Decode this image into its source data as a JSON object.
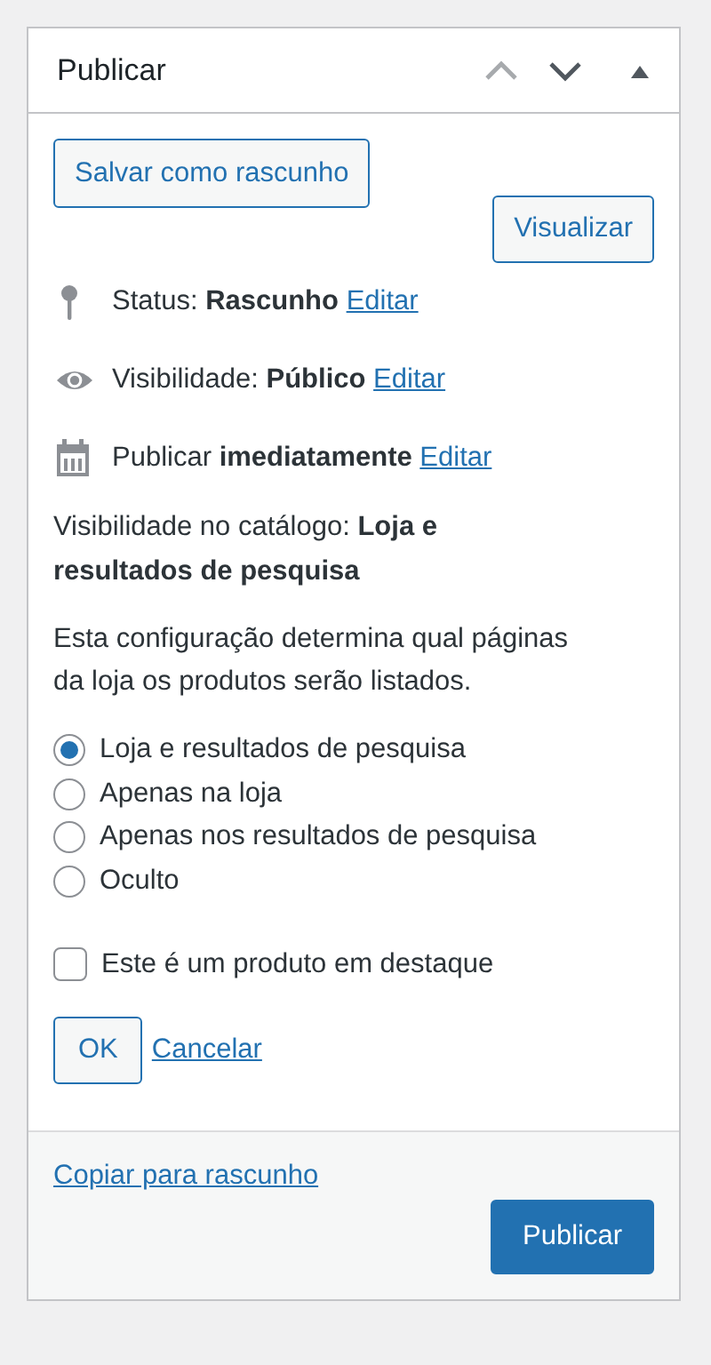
{
  "panel": {
    "title": "Publicar",
    "header_controls": [
      {
        "kind": "up",
        "disabled": true
      },
      {
        "kind": "down",
        "disabled": false
      },
      {
        "kind": "toggle",
        "disabled": false
      }
    ]
  },
  "actions": [
    {
      "label": "Salvar como rascunho"
    },
    {
      "label": "Visualizar"
    }
  ],
  "misc": [
    {
      "kind": "status",
      "label": "Status: ",
      "value": "Rascunho",
      "link": "Editar"
    },
    {
      "kind": "visibility",
      "label": "Visibilidade: ",
      "value": "Público",
      "link": "Editar"
    },
    {
      "kind": "schedule",
      "label": "Publicar ",
      "value": "imediatamente",
      "link": "Editar"
    }
  ],
  "catalog": {
    "text": "Visibilidade no catálogo: **Loja e resultados de pesquisa**",
    "description": "Esta configuração determina qual páginas da loja os produtos serão listados.",
    "options": [
      {
        "label": "Loja e resultados de pesquisa",
        "selected": true
      },
      {
        "label": "Apenas na loja",
        "selected": false
      },
      {
        "label": "Apenas nos resultados de pesquisa",
        "selected": false
      },
      {
        "label": "Oculto",
        "selected": false
      }
    ],
    "featured": {
      "label": "Este é um produto em destaque",
      "checked": false
    },
    "ok": "OK",
    "cancel": "Cancelar"
  },
  "footer": {
    "copy_link": "Copiar para rascunho",
    "publish": "Publicar"
  }
}
